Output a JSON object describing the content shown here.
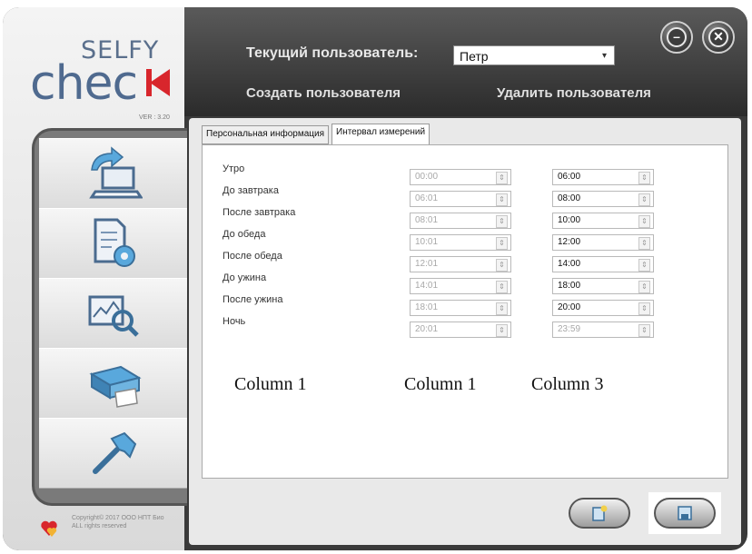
{
  "logo": {
    "selfy": "SELFY",
    "check": "chec",
    "version": "VER : 3.20"
  },
  "header": {
    "current_user_label": "Текущий пользователь:",
    "current_user_value": "Петр",
    "create_user": "Создать пользователя",
    "delete_user": "Удалить пользователя"
  },
  "tabs": [
    {
      "label": "Персональная информация"
    },
    {
      "label": "Интервал измерений"
    }
  ],
  "rows": [
    {
      "label": "Утро",
      "start": "00:00",
      "end": "06:00"
    },
    {
      "label": "До завтрака",
      "start": "06:01",
      "end": "08:00"
    },
    {
      "label": "После завтрака",
      "start": "08:01",
      "end": "10:00"
    },
    {
      "label": "До обеда",
      "start": "10:01",
      "end": "12:00"
    },
    {
      "label": "После обеда",
      "start": "12:01",
      "end": "14:00"
    },
    {
      "label": "До ужина",
      "start": "14:01",
      "end": "18:00"
    },
    {
      "label": "После ужина",
      "start": "18:01",
      "end": "20:00"
    },
    {
      "label": "Ночь",
      "start": "20:01",
      "end": "23:59"
    }
  ],
  "columns": [
    "Column 1",
    "Column 1",
    "Column 3"
  ],
  "footer": {
    "copyright_line1": "Copyright© 2017 OOO НПТ Био",
    "copyright_line2": "ALL rights reserved"
  },
  "icons": {
    "nav": [
      "import-to-computer-icon",
      "document-settings-icon",
      "chart-search-icon",
      "printer-icon",
      "hammer-icon"
    ],
    "window": [
      "minimize-icon",
      "close-icon"
    ],
    "bottom": [
      "new-document-icon",
      "save-icon"
    ]
  },
  "colors": {
    "accent_red": "#d8262c",
    "logo_blue": "#4f6a8f",
    "header_bg": "#2b2b2b"
  }
}
